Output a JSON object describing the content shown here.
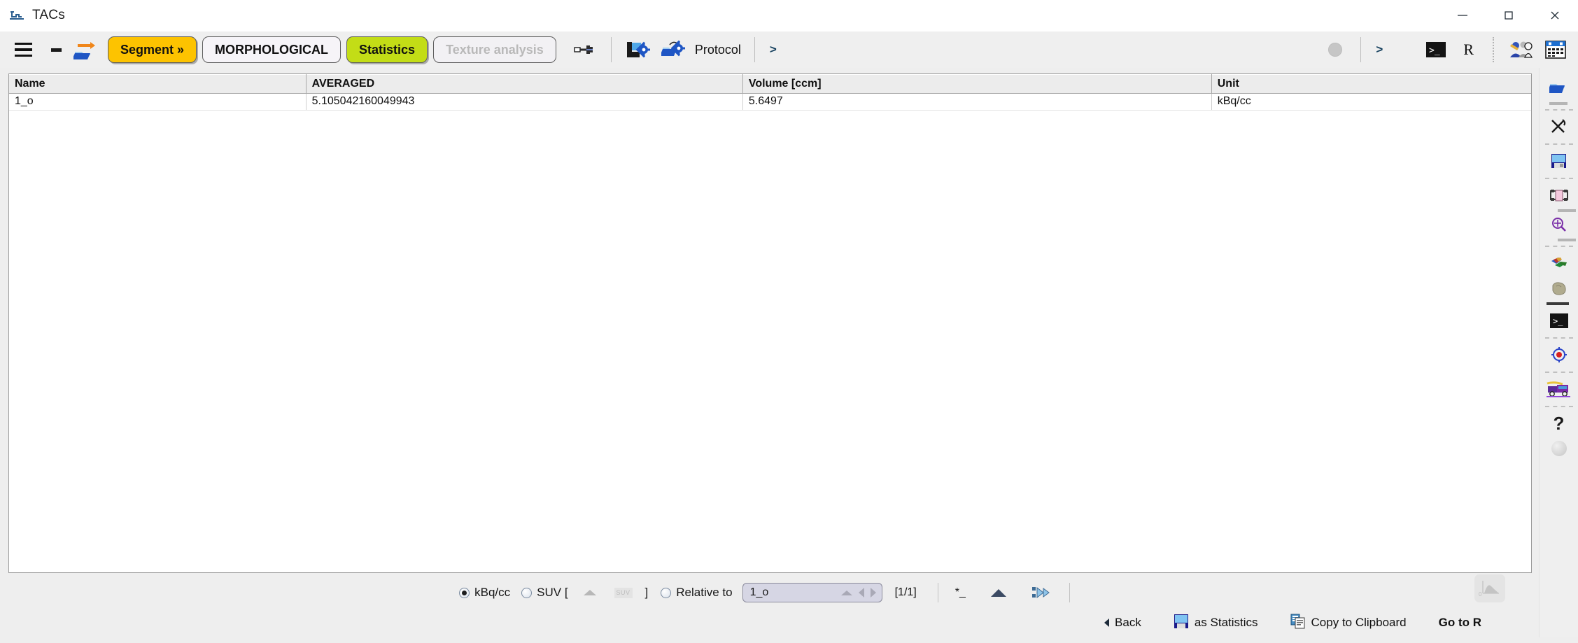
{
  "window": {
    "title": "TACs",
    "app_icon": "tac-chart-icon",
    "controls": [
      {
        "name": "minimize",
        "glyph": "—"
      },
      {
        "name": "maximize",
        "glyph": "□"
      },
      {
        "name": "close",
        "glyph": "✕"
      }
    ]
  },
  "toolbar": {
    "menu_icon": "hamburger-menu-icon",
    "minimize_icon": "minimize-dash-icon",
    "open_icon": "open-folder-arrow-icon",
    "buttons": [
      {
        "label": "Segment »",
        "state": "active-yellow",
        "name": "segment-button"
      },
      {
        "label": "MORPHOLOGICAL",
        "state": "normal",
        "name": "morphological-button"
      },
      {
        "label": "Statistics",
        "state": "selected-green",
        "name": "statistics-button"
      },
      {
        "label": "Texture analysis",
        "state": "disabled",
        "name": "texture-analysis-button"
      }
    ],
    "tool_icon": "wrench-tool-icon",
    "save_protocol_icon": "save-protocol-icon",
    "load_protocol_icon": "load-protocol-icon",
    "protocol_label": "Protocol",
    "chevron": ">",
    "gray_disc_icon": "gray-disc-icon",
    "chevron2": ">",
    "terminal_icon": "terminal-icon",
    "r_label": "R",
    "users_icon": "users-config-icon",
    "calendar_icon": "calendar-icon"
  },
  "table": {
    "columns": [
      "Name",
      "AVERAGED",
      "Volume [ccm]",
      "Unit"
    ],
    "rows": [
      [
        "1_o",
        "5.105042160049943",
        "5.6497",
        "kBq/cc"
      ]
    ]
  },
  "controls": {
    "unit_kbq_label": "kBq/cc",
    "unit_kbq_selected": true,
    "unit_suv_label": "SUV [",
    "unit_suv_selected": false,
    "suv_box_label": "SUV",
    "bracket_close": "]",
    "relative_label": "Relative to",
    "relative_selected": false,
    "relative_value": "1_o",
    "page_indicator": "[1/1]",
    "star_button": "*_",
    "triangle_icon": "triangle-up-icon",
    "export_icon": "export-arrow-icon",
    "chart_icon": "histogram-chart-icon"
  },
  "actions": {
    "back": "Back",
    "as_statistics": "as Statistics",
    "copy_to_clipboard": "Copy to Clipboard",
    "go_to_r": "Go to R"
  },
  "rail": {
    "items": [
      {
        "name": "open-folder-icon"
      },
      {
        "name": "scissors-cut-icon"
      },
      {
        "name": "save-floppy-icon"
      },
      {
        "name": "print-icon"
      },
      {
        "name": "zoom-in-icon"
      },
      {
        "name": "paint-brush-icon"
      },
      {
        "name": "stone-texture-icon"
      },
      {
        "name": "terminal-icon"
      },
      {
        "name": "target-icon"
      },
      {
        "name": "fire-truck-icon"
      },
      {
        "name": "help-question-icon"
      },
      {
        "name": "sphere-icon"
      }
    ],
    "help_glyph": "?"
  },
  "colors": {
    "accent_yellow": "#fdc300",
    "accent_green": "#c3dd16",
    "toolbar_bg": "#efefef",
    "panel_bg": "#ffffff",
    "disabled_text": "#b9b9b9"
  }
}
